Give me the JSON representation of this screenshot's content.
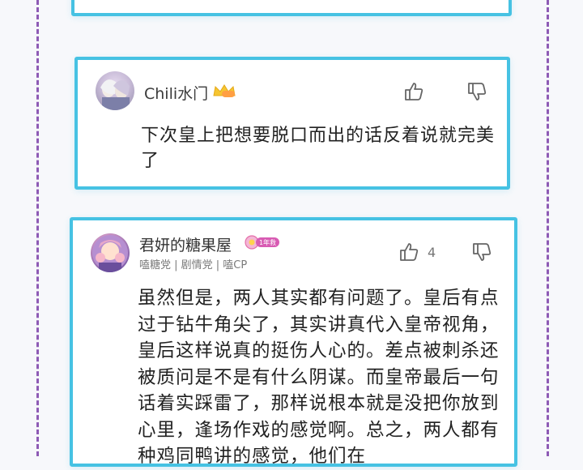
{
  "comments": [
    {
      "username": "Chili水门",
      "like_count": "",
      "text": "下次皇上把想要脱口而出的话反着说就完美了"
    },
    {
      "username": "君妍的糖果屋",
      "badge": "1年救",
      "tags": "嗑糖党 | 剧情党 | 嗑CP",
      "like_count": "4",
      "text": "虽然但是，两人其实都有问题了。皇后有点过于钻牛角尖了，其实讲真代入皇帝视角，皇后这样说真的挺伤人心的。差点被刺杀还被质问是不是有什么阴谋。而皇帝最后一句话着实踩雷了，那样说根本就是没把你放到心里，逢场作戏的感觉啊。总之，两人都有种鸡同鸭讲的感觉，他们在"
    }
  ],
  "colors": {
    "card_border": "#46c2e3",
    "dashed_border": "#8e5bb5"
  },
  "icons": [
    "thumbs-up-icon",
    "thumbs-down-icon",
    "crown-icon",
    "year-badge-icon"
  ]
}
